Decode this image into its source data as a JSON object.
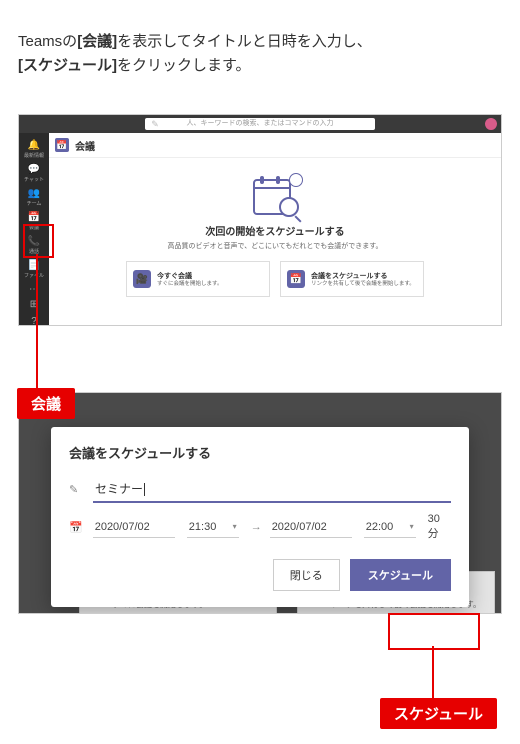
{
  "instruction": {
    "pre": "Teamsの",
    "b1": "[会議]",
    "mid": "を表示してタイトルと日時を入力し、",
    "b2": "[スケジュール]",
    "post": "をクリックします。"
  },
  "teams": {
    "search_placeholder": "人、キーワードの検索、またはコマンドの入力",
    "content_title": "会議",
    "rail": {
      "item0": "最新情報",
      "item1": "チャット",
      "item2": "チーム",
      "item3": "会議",
      "item4": "通話",
      "item5": "ファイル"
    },
    "empty": {
      "heading": "次回の開始をスケジュールする",
      "sub": "高品質のビデオと音声で、どこにいてもだれとでも会議ができます。",
      "card1": {
        "title": "今すぐ会議",
        "desc": "すぐに会議を開始します。"
      },
      "card2": {
        "title": "会議をスケジュールする",
        "desc": "リンクを共有して後で会議を開始します。"
      }
    }
  },
  "dialog": {
    "title": "会議をスケジュールする",
    "meeting_title": "セミナー",
    "start_date": "2020/07/02",
    "start_time": "21:30",
    "end_date": "2020/07/02",
    "end_time": "22:00",
    "duration": "30 分",
    "btn_close": "閉じる",
    "btn_schedule": "スケジュール"
  },
  "bg": {
    "card1_title": "今すぐ会議",
    "card1_desc": "すぐに会議を開始します。",
    "card2_title": "会議をスケジュールする",
    "card2_desc": "リンクを共有して後で会議を開始します。"
  },
  "callout": {
    "label1": "会議",
    "label2": "スケジュール"
  }
}
